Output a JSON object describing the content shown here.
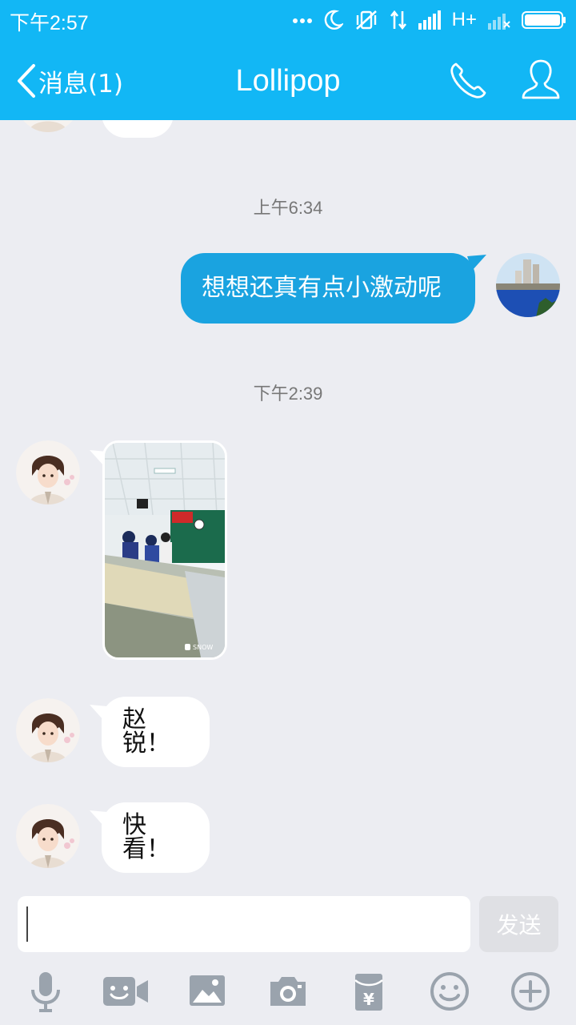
{
  "status_bar": {
    "time": "下午2:57",
    "network": "H+",
    "icons": [
      "more-dots-icon",
      "moon-icon",
      "vibrate-off-icon",
      "data-arrows-icon",
      "signal-icon",
      "signal-icon",
      "battery-icon"
    ]
  },
  "header": {
    "back_label": "消息(1)",
    "title": "Lollipop",
    "accent_color": "#12b7f5"
  },
  "messages": [
    {
      "type": "timestamp",
      "text": "上午6:34"
    },
    {
      "type": "text",
      "direction": "outgoing",
      "text": "想想还真有点小激动呢"
    },
    {
      "type": "timestamp",
      "text": "下午2:39"
    },
    {
      "type": "image",
      "direction": "incoming",
      "watermark": "SNOW"
    },
    {
      "type": "text",
      "direction": "incoming",
      "text": "赵锐！"
    },
    {
      "type": "text",
      "direction": "incoming",
      "text": "快看！"
    }
  ],
  "input": {
    "value": "",
    "send_label": "发送"
  },
  "toolbar": {
    "tools": [
      "microphone-icon",
      "video-call-icon",
      "photo-icon",
      "camera-icon",
      "red-packet-icon",
      "emoji-icon",
      "plus-icon"
    ]
  }
}
